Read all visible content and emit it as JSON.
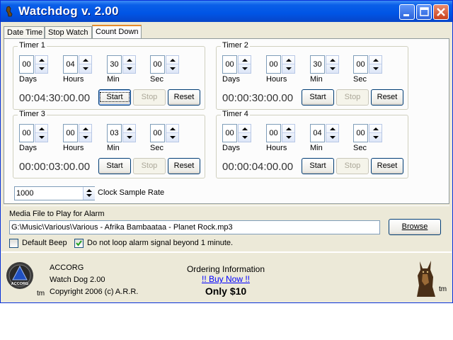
{
  "window": {
    "title": "Watchdog v. 2.00"
  },
  "tabs": [
    {
      "label": "Date Time"
    },
    {
      "label": "Stop Watch"
    },
    {
      "label": "Count Down"
    }
  ],
  "units": {
    "days": "Days",
    "hours": "Hours",
    "min": "Min",
    "sec": "Sec"
  },
  "buttons": {
    "start": "Start",
    "stop": "Stop",
    "reset": "Reset",
    "browse": "Browse"
  },
  "timers": [
    {
      "label": "Timer 1",
      "days": "00",
      "hours": "04",
      "min": "30",
      "sec": "00",
      "readout": "00:04:30:00.00",
      "start_focused": true
    },
    {
      "label": "Timer 2",
      "days": "00",
      "hours": "00",
      "min": "30",
      "sec": "00",
      "readout": "00:00:30:00.00"
    },
    {
      "label": "Timer 3",
      "days": "00",
      "hours": "00",
      "min": "03",
      "sec": "00",
      "readout": "00:00:03:00.00"
    },
    {
      "label": "Timer 4",
      "days": "00",
      "hours": "00",
      "min": "04",
      "sec": "00",
      "readout": "00:00:04:00.00"
    }
  ],
  "sample_rate": {
    "value": "1000",
    "label": "Clock Sample Rate"
  },
  "media": {
    "label": "Media File to Play for Alarm",
    "path": "G:\\Music\\Various\\Various - Afrika Bambaataa - Planet Rock.mp3",
    "default_beep": {
      "label": "Default Beep",
      "checked": false
    },
    "no_loop": {
      "label": "Do not loop alarm signal beyond 1 minute.",
      "checked": true
    }
  },
  "footer": {
    "logo_text": "ACCORG",
    "tm": "tm",
    "company": "ACCORG",
    "product": "Watch Dog 2.00",
    "copyright": "Copyright 2006 (c) A.R.R.",
    "ordering_title": "Ordering Information",
    "buy_link": "!! Buy Now !!",
    "price": "Only $10"
  },
  "colors": {
    "titlebar": "#0055e5",
    "accent_tab": "#e68b2c",
    "link": "#0000ff"
  }
}
